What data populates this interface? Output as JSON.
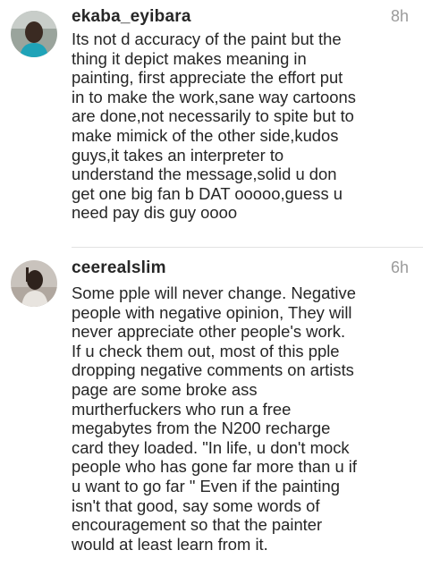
{
  "comments": [
    {
      "username": "ekaba_eyibara",
      "time": "8h",
      "lines": [
        "Its not d accuracy of the paint but the",
        "thing it depict makes meaning in",
        "painting, first appreciate the effort put",
        "in to make the work,sane way cartoons",
        "are done,not necessarily to spite but to",
        "make mimick of the other side,kudos",
        "guys,it takes an interpreter to",
        "understand the message,solid u don",
        "get one big fan b DAT ooooo,guess u",
        "need pay dis guy oooo"
      ]
    },
    {
      "username": "ceerealslim",
      "time": "6h",
      "lines": [
        "Some pple will never change. Negative",
        "people with negative opinion, They will",
        "never appreciate other people's work.",
        "If u check them out, most of this pple",
        "dropping negative comments on artists",
        "page are some broke ass",
        "murtherfuckers who run a free",
        "megabytes from the N200 recharge",
        "card they loaded. \"In life, u don't mock",
        "people who has gone far more than u if",
        "u want to go far \" Even if the painting",
        "isn't that good, say some words of",
        "encouragement so that the painter",
        "would at least learn from it."
      ]
    }
  ]
}
